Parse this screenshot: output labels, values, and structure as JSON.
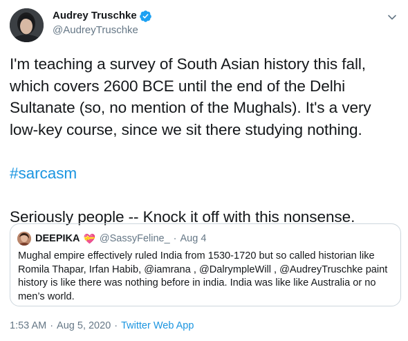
{
  "author": {
    "display_name": "Audrey Truschke",
    "handle": "@AudreyTruschke",
    "verified": true
  },
  "tweet": {
    "text_main": "I'm teaching a survey of South Asian history this fall, which covers 2600 BCE until the end of the Delhi Sultanate (so, no mention of the Mughals). It's a very low-key course, since we sit there studying nothing.",
    "hashtag": "#sarcasm",
    "text_closing": "Seriously people -- Knock it off with this nonsense."
  },
  "quoted_tweet": {
    "display_name": "DEEPIKA",
    "emoji": "💝",
    "handle": "@SassyFeline_",
    "separator": "·",
    "date": "Aug 4",
    "text": "Mughal empire effectively ruled India from 1530-1720 but so called historian like Romila Thapar, Irfan Habib, @iamrana , @DalrympleWill , @AudreyTruschke paint history is like there was nothing before in india. India was like like Australia or no men’s world."
  },
  "meta": {
    "time": "1:53 AM",
    "separator": "·",
    "date": "Aug 5, 2020",
    "source": "Twitter Web App"
  },
  "colors": {
    "link": "#1b95e0",
    "secondary_text": "#657786",
    "border": "#ccd6dd",
    "verified": "#1da1f2"
  },
  "icons": {
    "verified": "verified-badge-icon",
    "more": "chevron-down-icon"
  }
}
